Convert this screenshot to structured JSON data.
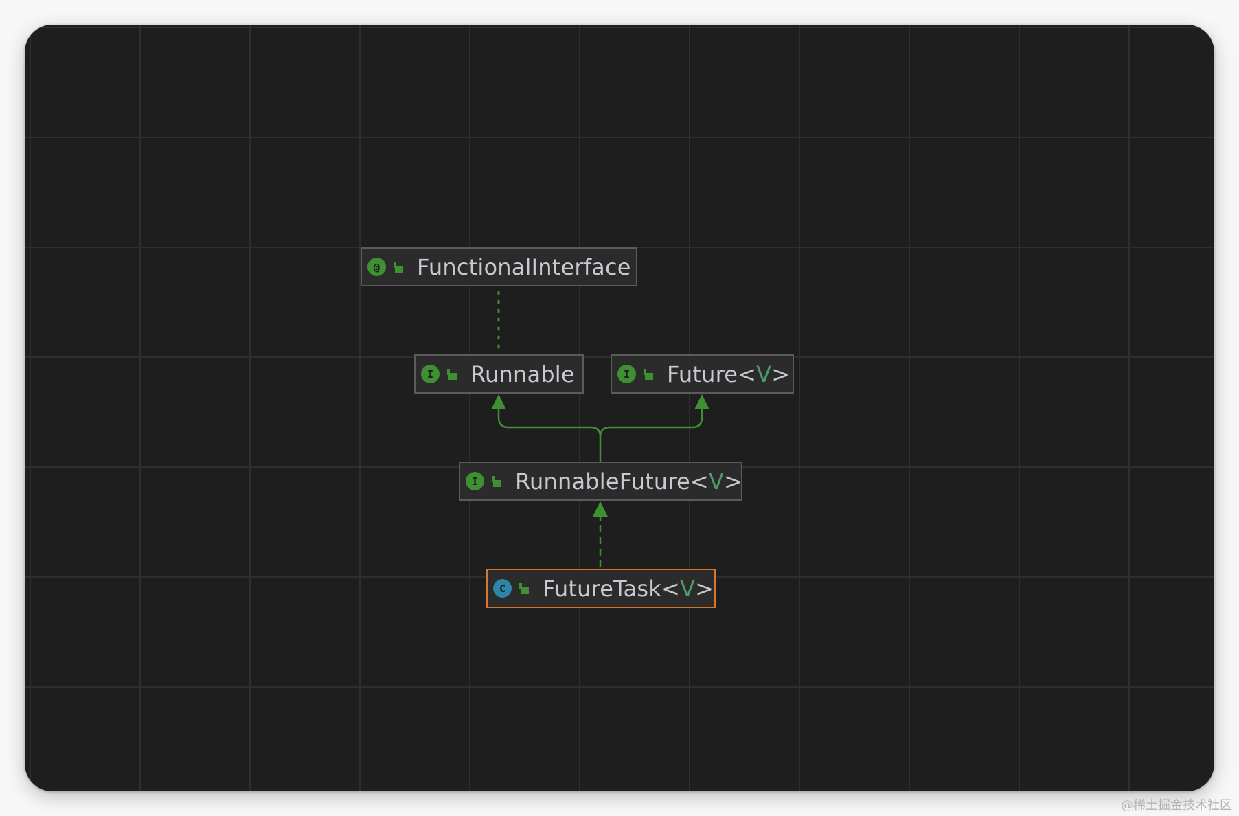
{
  "colors": {
    "canvas_background": "#1e1e1e",
    "node_border": "#5b5b5b",
    "selected_border": "#d7772f",
    "edge_green": "#3f8f33",
    "interface_icon": "#3f8f33",
    "class_icon": "#2d86a8",
    "type_parameter": "#4f9a68"
  },
  "nodes": {
    "functional_interface": {
      "icon_letter": "@",
      "icon_name": "annotation-icon",
      "label": "FunctionalInterface"
    },
    "runnable": {
      "icon_letter": "I",
      "icon_name": "interface-icon",
      "label": "Runnable"
    },
    "future": {
      "icon_letter": "I",
      "icon_name": "interface-icon",
      "label": "Future",
      "open": "<",
      "type_param": "V",
      "close": ">"
    },
    "runnable_future": {
      "icon_letter": "I",
      "icon_name": "interface-icon",
      "label": "RunnableFuture",
      "open": "<",
      "type_param": "V",
      "close": ">"
    },
    "future_task": {
      "icon_letter": "C",
      "icon_name": "class-icon",
      "label": "FutureTask",
      "open": "<",
      "type_param": "V",
      "close": ">",
      "selected": true
    }
  },
  "edges": [
    {
      "from": "runnable",
      "to": "functional_interface",
      "style": "dotted",
      "kind": "annotation"
    },
    {
      "from": "runnable_future",
      "to": "runnable",
      "style": "solid",
      "kind": "extends"
    },
    {
      "from": "runnable_future",
      "to": "future",
      "style": "solid",
      "kind": "extends"
    },
    {
      "from": "future_task",
      "to": "runnable_future",
      "style": "dashed",
      "kind": "implements"
    }
  ],
  "watermark": "@稀土掘金技术社区"
}
